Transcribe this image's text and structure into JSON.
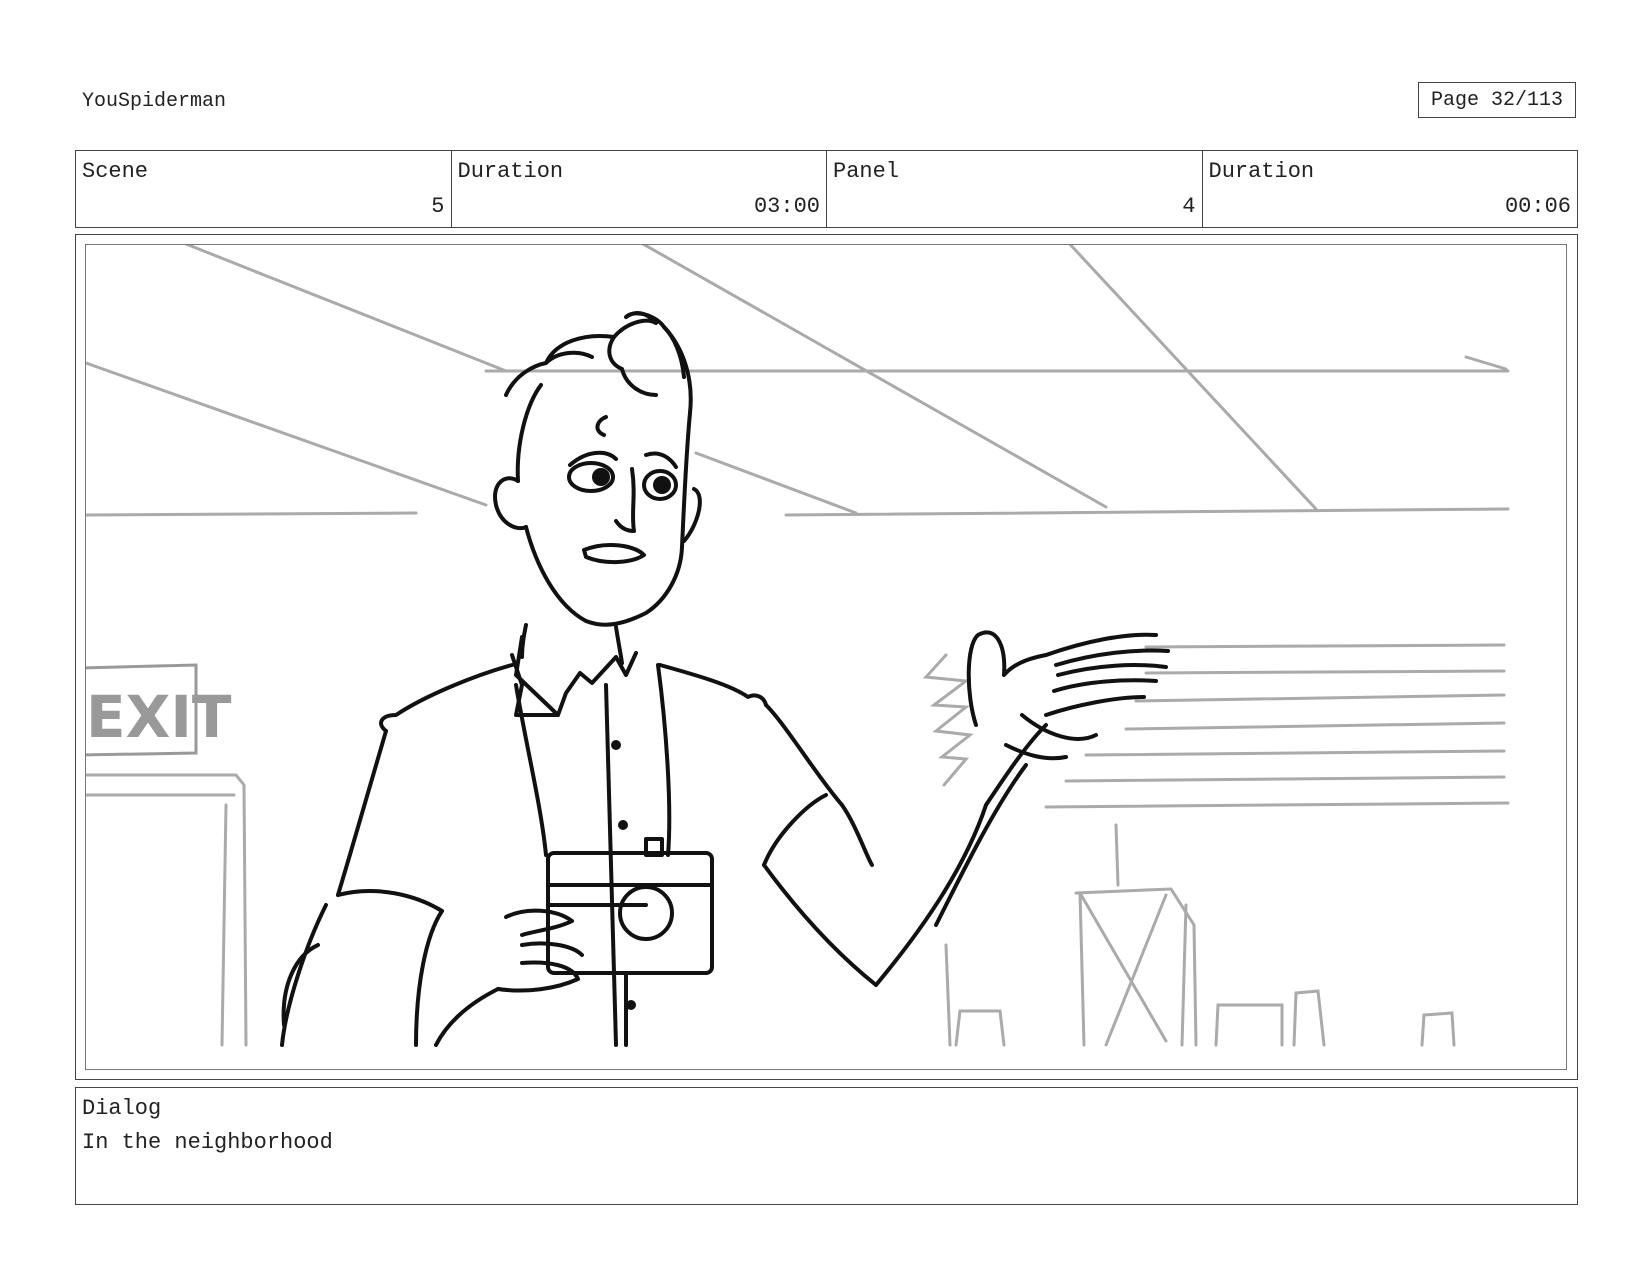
{
  "header": {
    "project_title": "YouSpiderman",
    "page_label": "Page",
    "page_number": "32/113"
  },
  "info": {
    "scene_label": "Scene",
    "scene_value": "5",
    "scene_duration_label": "Duration",
    "scene_duration_value": "03:00",
    "panel_label": "Panel",
    "panel_value": "4",
    "panel_duration_label": "Duration",
    "panel_duration_value": "00:06"
  },
  "panel": {
    "sign_text": "EXIT"
  },
  "dialog": {
    "label": "Dialog",
    "text": "In the neighborhood"
  }
}
